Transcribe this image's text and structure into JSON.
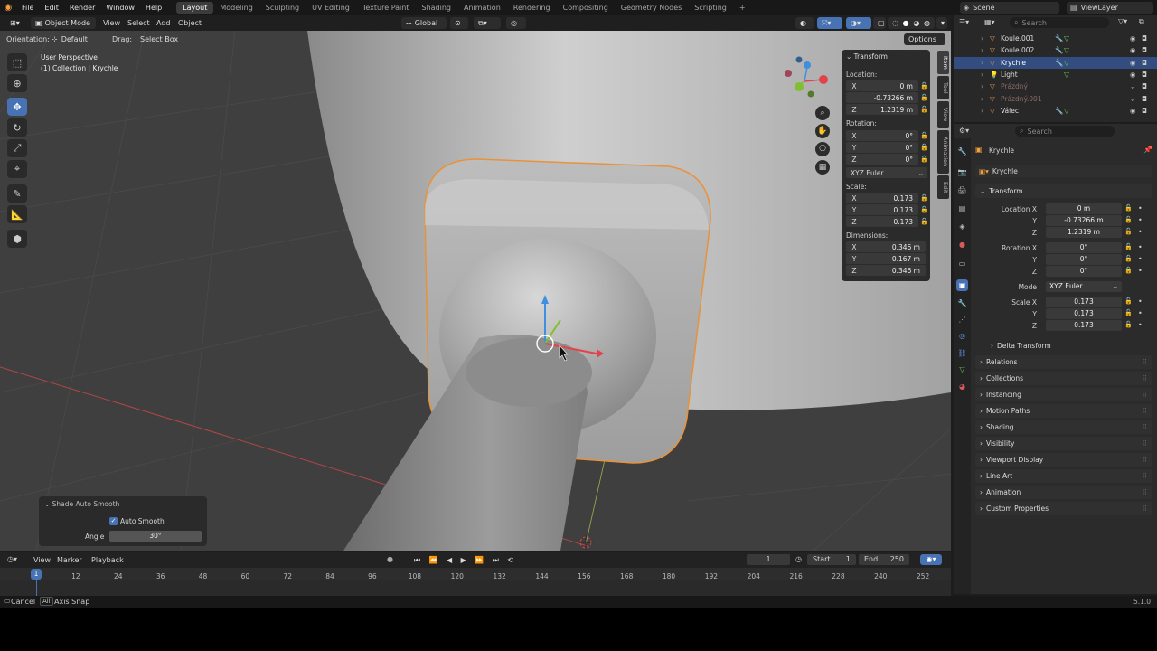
{
  "topbar": {
    "menus": [
      "File",
      "Edit",
      "Render",
      "Window",
      "Help"
    ],
    "workspaces": [
      "Layout",
      "Modeling",
      "Sculpting",
      "UV Editing",
      "Texture Paint",
      "Shading",
      "Animation",
      "Rendering",
      "Compositing",
      "Geometry Nodes",
      "Scripting"
    ],
    "active_workspace": "Layout",
    "add_tab": "+",
    "scene": "Scene",
    "view_layer": "ViewLayer"
  },
  "viewport_header": {
    "mode": "Object Mode",
    "menus": [
      "View",
      "Select",
      "Add",
      "Object"
    ],
    "transform_orientation": "Global",
    "options": "Options"
  },
  "tool_header": {
    "orientation_label": "Orientation:",
    "orientation_value": "Default",
    "drag_label": "Drag:",
    "drag_value": "Select Box"
  },
  "viewport": {
    "view_name": "User Perspective",
    "collection_info": "(1) Collection | Krychle"
  },
  "npanel": {
    "title": "Transform",
    "location_label": "Location:",
    "location": [
      {
        "axis": "X",
        "value": "0 m"
      },
      {
        "axis": "Y",
        "value": "-0.73266 m"
      },
      {
        "axis": "Z",
        "value": "1.2319 m"
      }
    ],
    "rotation_label": "Rotation:",
    "rotation": [
      {
        "axis": "X",
        "value": "0°"
      },
      {
        "axis": "Y",
        "value": "0°"
      },
      {
        "axis": "Z",
        "value": "0°"
      }
    ],
    "rotation_mode": "XYZ Euler",
    "scale_label": "Scale:",
    "scale": [
      {
        "axis": "X",
        "value": "0.173"
      },
      {
        "axis": "Y",
        "value": "0.173"
      },
      {
        "axis": "Z",
        "value": "0.173"
      }
    ],
    "dimensions_label": "Dimensions:",
    "dimensions": [
      {
        "axis": "X",
        "value": "0.346 m"
      },
      {
        "axis": "Y",
        "value": "0.167 m"
      },
      {
        "axis": "Z",
        "value": "0.346 m"
      }
    ],
    "tabs": [
      "Item",
      "Tool",
      "View",
      "Animation",
      "Edit"
    ]
  },
  "shade_panel": {
    "title": "Shade Auto Smooth",
    "auto_smooth_label": "Auto Smooth",
    "auto_smooth_checked": true,
    "angle_label": "Angle",
    "angle_value": "30°"
  },
  "timeline": {
    "menus": [
      "View",
      "Marker",
      "Playback"
    ],
    "current_frame": "1",
    "start_label": "Start",
    "start_value": "1",
    "end_label": "End",
    "end_value": "250",
    "ticks": [
      "1",
      "12",
      "24",
      "36",
      "48",
      "60",
      "72",
      "84",
      "96",
      "108",
      "120",
      "132",
      "144",
      "156",
      "168",
      "180",
      "192",
      "204",
      "216",
      "228",
      "240",
      "252"
    ],
    "playhead_frame": "1"
  },
  "statusbar": {
    "cancel": "Cancel",
    "axis_snap_key": "All",
    "axis_snap": "Axis Snap",
    "version": "5.1.0"
  },
  "outliner": {
    "search_placeholder": "Search",
    "items": [
      {
        "name": "Koule.001",
        "selected": false,
        "disabled": false
      },
      {
        "name": "Koule.002",
        "selected": false,
        "disabled": false
      },
      {
        "name": "Krychle",
        "selected": true,
        "disabled": false
      },
      {
        "name": "Light",
        "selected": false,
        "disabled": false
      },
      {
        "name": "Prázdný",
        "selected": false,
        "disabled": true
      },
      {
        "name": "Prázdný.001",
        "selected": false,
        "disabled": true
      },
      {
        "name": "Válec",
        "selected": false,
        "disabled": false
      }
    ]
  },
  "properties": {
    "search_placeholder": "Search",
    "object_name": "Krychle",
    "object_field": "Krychle",
    "transform_title": "Transform",
    "location_x_label": "Location X",
    "y_label": "Y",
    "z_label": "Z",
    "location": [
      "0 m",
      "-0.73266 m",
      "1.2319 m"
    ],
    "rotation_x_label": "Rotation X",
    "rotation": [
      "0°",
      "0°",
      "0°"
    ],
    "mode_label": "Mode",
    "mode_value": "XYZ Euler",
    "scale_x_label": "Scale X",
    "scale": [
      "0.173",
      "0.173",
      "0.173"
    ],
    "delta_transform": "Delta Transform",
    "sections": [
      "Relations",
      "Collections",
      "Instancing",
      "Motion Paths",
      "Shading",
      "Visibility",
      "Viewport Display",
      "Line Art",
      "Animation",
      "Custom Properties"
    ]
  },
  "colors": {
    "accent": "#4772b3",
    "selection_outline": "#e8923a",
    "axis_x": "#e2434b",
    "axis_y": "#7fbf30",
    "axis_z": "#3f8fe0"
  }
}
